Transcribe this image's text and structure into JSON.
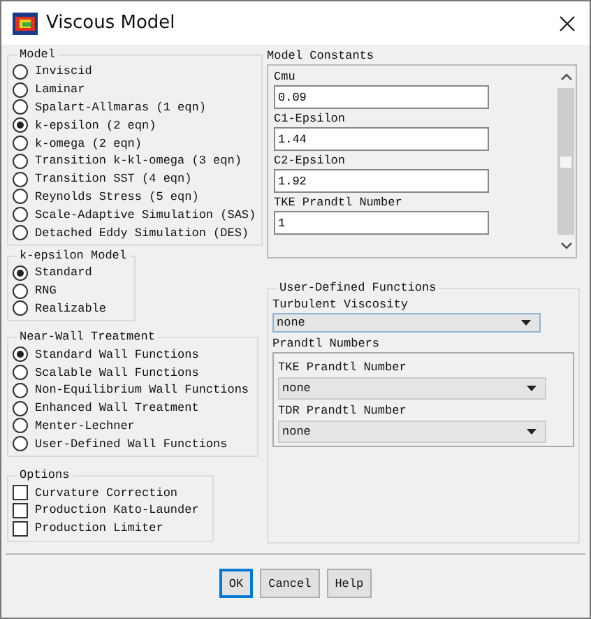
{
  "window": {
    "title": "Viscous Model"
  },
  "model": {
    "title": "Model",
    "options": [
      {
        "label": "Inviscid",
        "selected": false
      },
      {
        "label": "Laminar",
        "selected": false
      },
      {
        "label": "Spalart-Allmaras (1 eqn)",
        "selected": false
      },
      {
        "label": "k-epsilon (2 eqn)",
        "selected": true
      },
      {
        "label": "k-omega (2 eqn)",
        "selected": false
      },
      {
        "label": "Transition k-kl-omega (3 eqn)",
        "selected": false
      },
      {
        "label": "Transition SST (4 eqn)",
        "selected": false
      },
      {
        "label": "Reynolds Stress (5 eqn)",
        "selected": false
      },
      {
        "label": "Scale-Adaptive Simulation (SAS)",
        "selected": false
      },
      {
        "label": "Detached Eddy Simulation (DES)",
        "selected": false
      }
    ]
  },
  "k_epsilon_model": {
    "title": "k-epsilon Model",
    "options": [
      {
        "label": "Standard",
        "selected": true
      },
      {
        "label": "RNG",
        "selected": false
      },
      {
        "label": "Realizable",
        "selected": false
      }
    ]
  },
  "near_wall_treatment": {
    "title": "Near-Wall Treatment",
    "options": [
      {
        "label": "Standard Wall Functions",
        "selected": true
      },
      {
        "label": "Scalable Wall Functions",
        "selected": false
      },
      {
        "label": "Non-Equilibrium Wall Functions",
        "selected": false
      },
      {
        "label": "Enhanced Wall Treatment",
        "selected": false
      },
      {
        "label": "Menter-Lechner",
        "selected": false
      },
      {
        "label": "User-Defined Wall Functions",
        "selected": false
      }
    ]
  },
  "options": {
    "title": "Options",
    "items": [
      {
        "label": "Curvature Correction",
        "checked": false
      },
      {
        "label": "Production Kato-Launder",
        "checked": false
      },
      {
        "label": "Production Limiter",
        "checked": false
      }
    ]
  },
  "model_constants": {
    "title": "Model Constants",
    "fields": [
      {
        "label": "Cmu",
        "value": "0.09"
      },
      {
        "label": "C1-Epsilon",
        "value": "1.44"
      },
      {
        "label": "C2-Epsilon",
        "value": "1.92"
      },
      {
        "label": "TKE Prandtl Number",
        "value": "1"
      }
    ]
  },
  "user_defined_functions": {
    "title": "User-Defined Functions",
    "turbulent_viscosity": {
      "label": "Turbulent Viscosity",
      "value": "none"
    },
    "prandtl_numbers": {
      "label": "Prandtl Numbers",
      "fields": [
        {
          "label": "TKE Prandtl Number",
          "value": "none"
        },
        {
          "label": "TDR Prandtl Number",
          "value": "none"
        }
      ]
    }
  },
  "buttons": [
    {
      "label": "OK",
      "default": true
    },
    {
      "label": "Cancel",
      "default": false
    },
    {
      "label": "Help",
      "default": false
    }
  ]
}
